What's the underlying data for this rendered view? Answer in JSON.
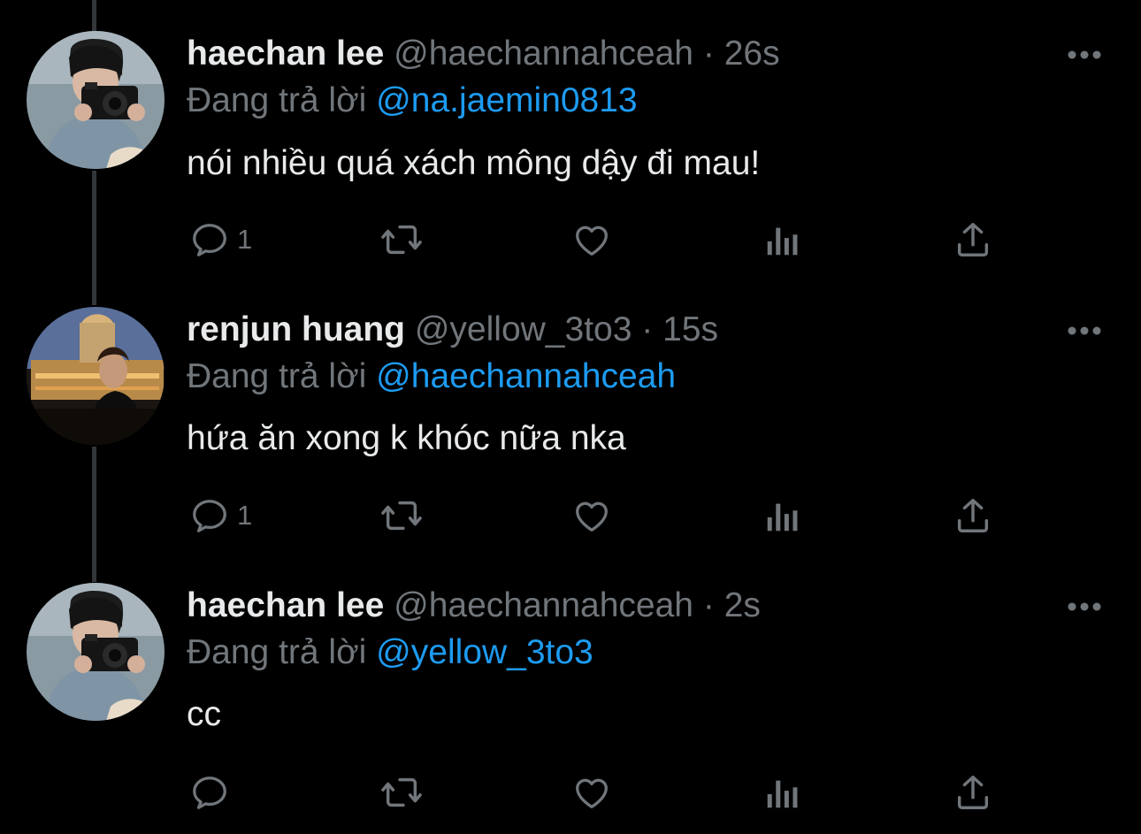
{
  "colors": {
    "background": "#000000",
    "text": "#e7e9ea",
    "muted": "#71767b",
    "mention": "#1d9bf0",
    "thread_line": "#333639"
  },
  "tweets": [
    {
      "name": "haechan lee",
      "handle": "@haechannahceah",
      "separator": "·",
      "time": "26s",
      "replying_prefix": "Đang trả lời",
      "replying_to": "@na.jaemin0813",
      "text": "nói nhiều quá xách mông dậy đi mau!",
      "reply_count": "1",
      "icons": [
        "reply-icon",
        "retweet-icon",
        "like-icon",
        "views-icon",
        "share-icon",
        "more-icon"
      ]
    },
    {
      "name": "renjun huang",
      "handle": "@yellow_3to3",
      "separator": "·",
      "time": "15s",
      "replying_prefix": "Đang trả lời",
      "replying_to": "@haechannahceah",
      "text": "hứa ăn xong k khóc nữa nka",
      "reply_count": "1",
      "icons": [
        "reply-icon",
        "retweet-icon",
        "like-icon",
        "views-icon",
        "share-icon",
        "more-icon"
      ]
    },
    {
      "name": "haechan lee",
      "handle": "@haechannahceah",
      "separator": "·",
      "time": "2s",
      "replying_prefix": "Đang trả lời",
      "replying_to": "@yellow_3to3",
      "text": "cc",
      "reply_count": "",
      "icons": [
        "reply-icon",
        "retweet-icon",
        "like-icon",
        "views-icon",
        "share-icon",
        "more-icon"
      ]
    }
  ]
}
